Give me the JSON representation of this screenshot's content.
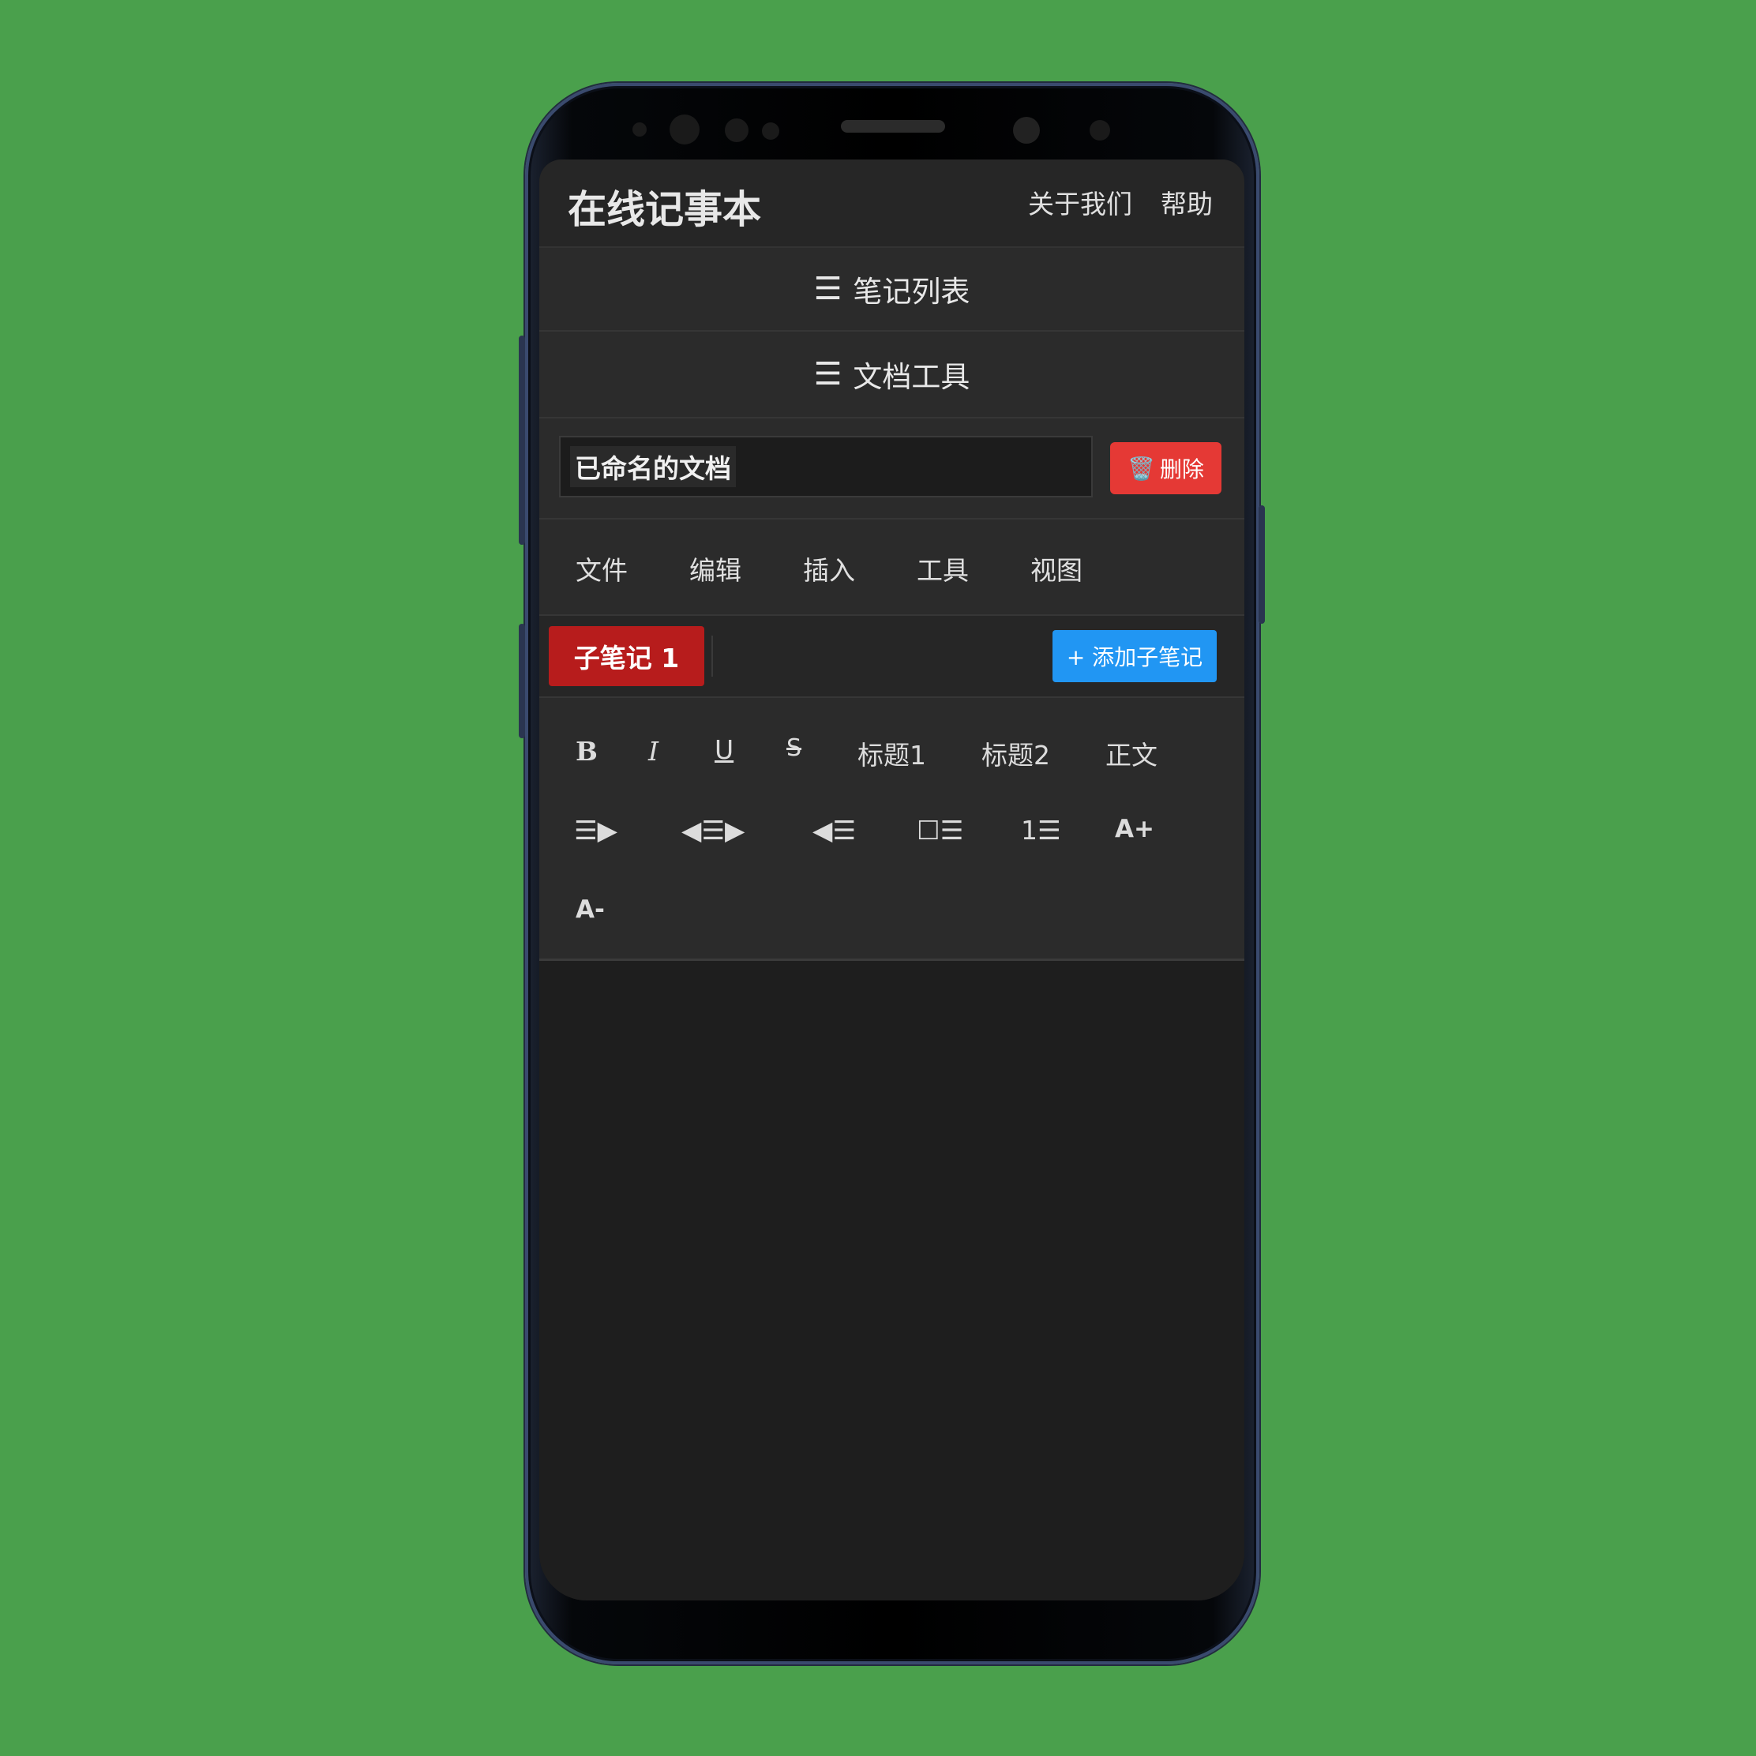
{
  "header": {
    "app_title": "在线记事本",
    "links": [
      "关于我们",
      "帮助"
    ]
  },
  "sections": {
    "note_list": "笔记列表",
    "doc_tools": "文档工具",
    "menu_icon": "☰"
  },
  "document": {
    "title_value": "已命名的文档",
    "delete_label": "删除",
    "delete_icon": "🗑️"
  },
  "menu": [
    "文件",
    "编辑",
    "插入",
    "工具",
    "视图"
  ],
  "subnotes": {
    "active_tab": "子笔记 1",
    "add_label": "+ 添加子笔记"
  },
  "format_toolbar": {
    "bold": "B",
    "italic": "I",
    "underline": "U",
    "strike": "S",
    "heading1": "标题1",
    "heading2": "标题2",
    "body": "正文",
    "indent": "☰▶",
    "center": "◀☰▶",
    "outdent": "◀☰",
    "checklist": "☐☰",
    "ordered_list": "1☰",
    "font_increase": "A+",
    "font_decrease": "A-"
  },
  "colors": {
    "background": "#4aa04c",
    "delete": "#e53935",
    "active_tab": "#b71c1c",
    "add_button": "#2196f3"
  }
}
